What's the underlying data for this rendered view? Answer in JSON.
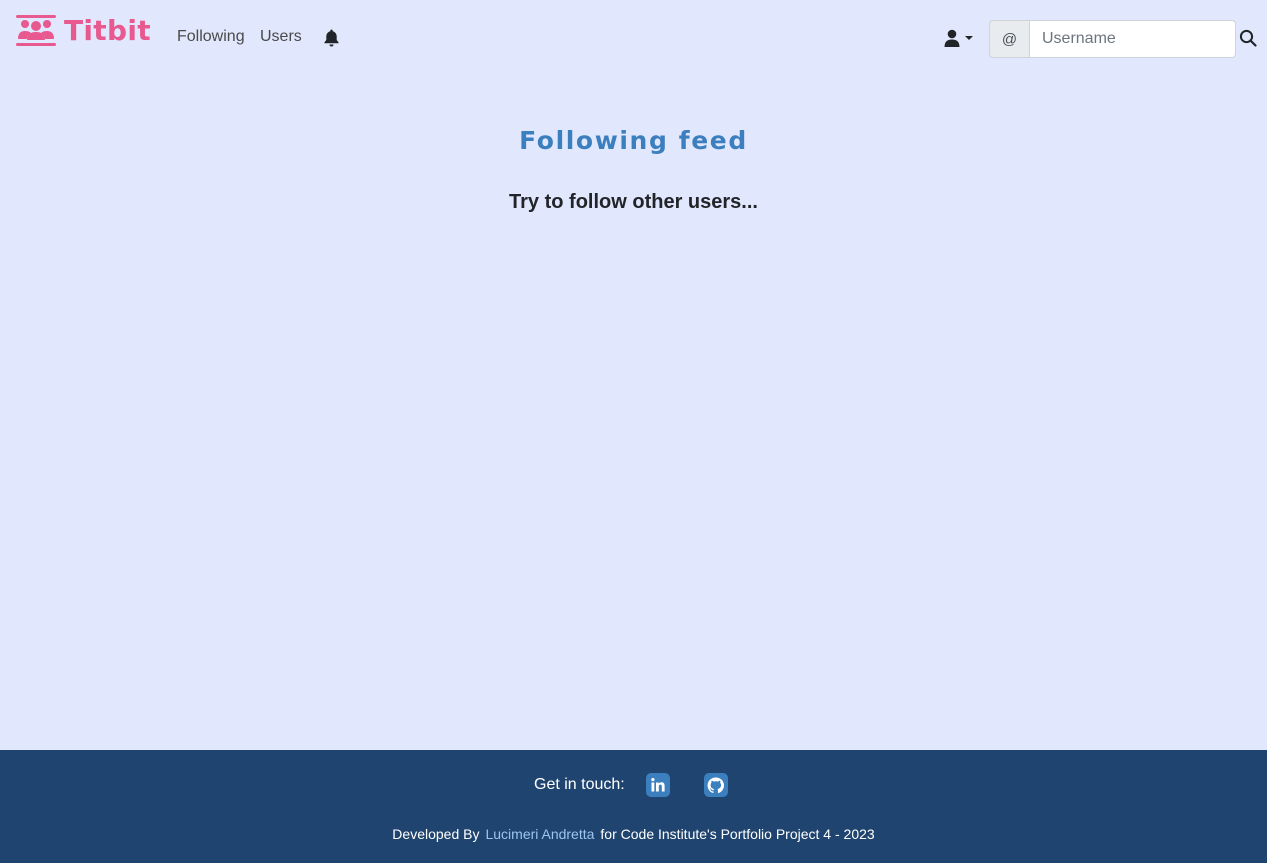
{
  "brand": {
    "name": "Titbit",
    "icon": "users-group-icon",
    "color": "#e8598f"
  },
  "nav": {
    "following_label": "Following",
    "users_label": "Users",
    "notifications_icon": "bell-icon",
    "profile_icon": "user-icon"
  },
  "search": {
    "prefix": "@",
    "placeholder": "Username",
    "button_icon": "search-icon"
  },
  "main": {
    "title": "Following feed",
    "empty_message": "Try to follow other users..."
  },
  "footer": {
    "get_in_touch": "Get in touch:",
    "social": [
      {
        "name": "LinkedIn",
        "icon": "linkedin-icon"
      },
      {
        "name": "GitHub",
        "icon": "github-icon"
      }
    ],
    "developed_by": "Developed By",
    "author": "Lucimeri Andretta",
    "credit_suffix": "for Code Institute's Portfolio Project 4 - 2023"
  },
  "colors": {
    "page_bg": "#e1e7fc",
    "accent": "#3c7fbf",
    "footer_bg": "#1f446f"
  }
}
